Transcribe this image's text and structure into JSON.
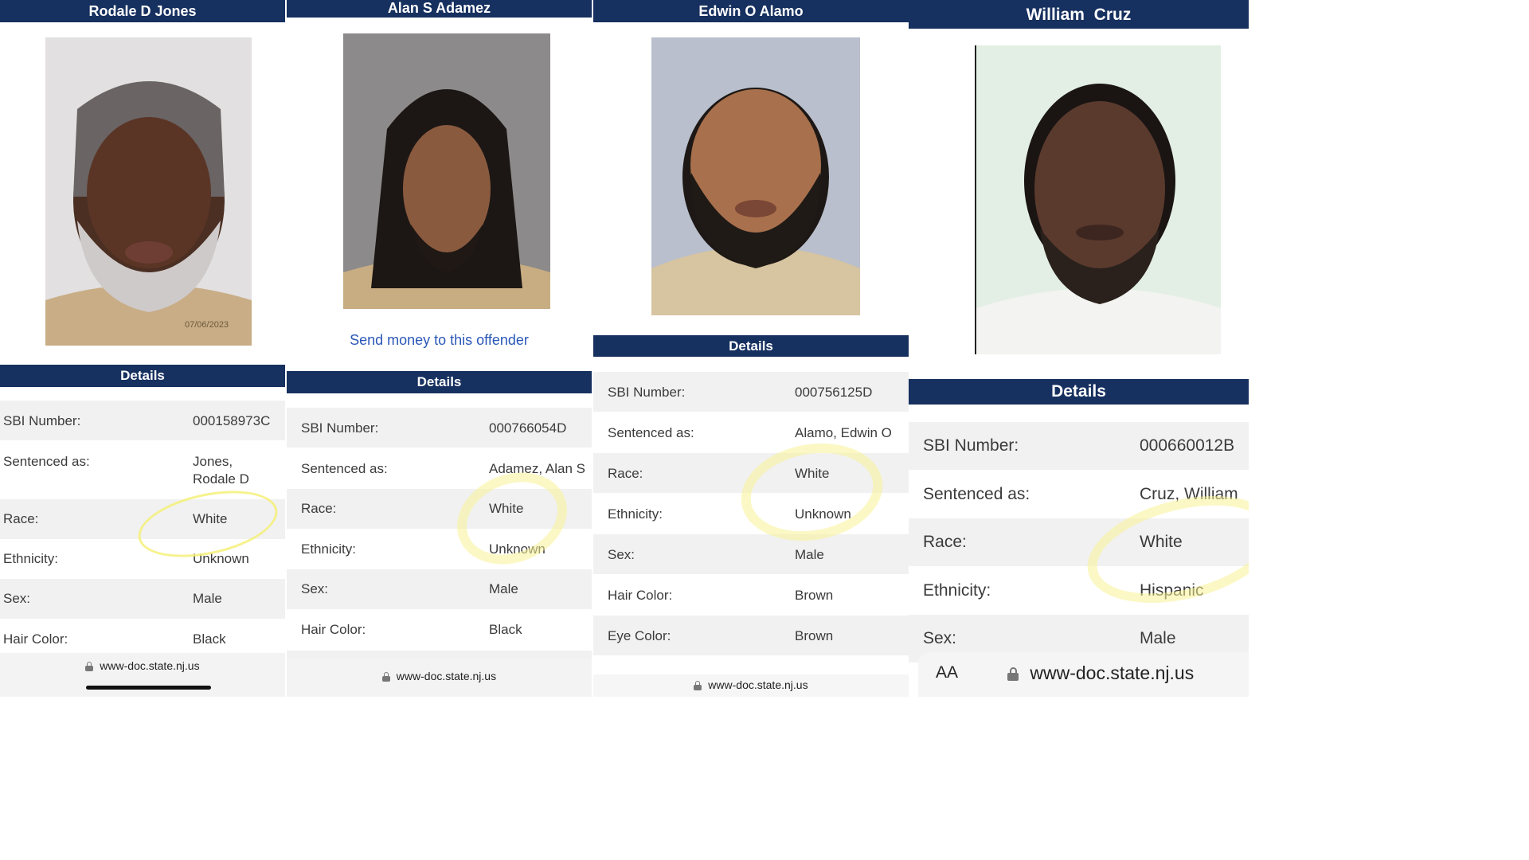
{
  "panels": [
    {
      "name": "Rodale D Jones",
      "details_heading": "Details",
      "photo_stamp": "07/06/2023",
      "rows": [
        {
          "label": "SBI Number:",
          "value": "000158973C"
        },
        {
          "label": "Sentenced as:",
          "value": "Jones,",
          "value2": "Rodale D"
        },
        {
          "label": "Race:",
          "value": "White"
        },
        {
          "label": "Ethnicity:",
          "value": "Unknown"
        },
        {
          "label": "Sex:",
          "value": "Male"
        },
        {
          "label": "Hair Color:",
          "value": "Black"
        }
      ],
      "url": "www-doc.state.nj.us"
    },
    {
      "name": "Alan S Adamez",
      "link": "Send money to this offender",
      "details_heading": "Details",
      "rows": [
        {
          "label": "SBI Number:",
          "value": "000766054D"
        },
        {
          "label": "Sentenced as:",
          "value": "Adamez, Alan S"
        },
        {
          "label": "Race:",
          "value": "White"
        },
        {
          "label": "Ethnicity:",
          "value": "Unknown"
        },
        {
          "label": "Sex:",
          "value": "Male"
        },
        {
          "label": "Hair Color:",
          "value": "Black"
        }
      ],
      "url": "www-doc.state.nj.us"
    },
    {
      "name": "Edwin O Alamo",
      "details_heading": "Details",
      "rows": [
        {
          "label": "SBI Number:",
          "value": "000756125D"
        },
        {
          "label": "Sentenced as:",
          "value": "Alamo, Edwin O"
        },
        {
          "label": "Race:",
          "value": "White"
        },
        {
          "label": "Ethnicity:",
          "value": "Unknown"
        },
        {
          "label": "Sex:",
          "value": "Male"
        },
        {
          "label": "Hair Color:",
          "value": "Brown"
        },
        {
          "label": "Eye Color:",
          "value": "Brown"
        }
      ],
      "url": "www-doc.state.nj.us"
    },
    {
      "name": "William  Cruz",
      "details_heading": "Details",
      "rows": [
        {
          "label": "SBI Number:",
          "value": "000660012B"
        },
        {
          "label": "Sentenced as:",
          "value": "Cruz, William"
        },
        {
          "label": "Race:",
          "value": "White"
        },
        {
          "label": "Ethnicity:",
          "value": "Hispanic"
        },
        {
          "label": "Sex:",
          "value": "Male"
        }
      ],
      "text_size_button": "AA",
      "url": "www-doc.state.nj.us"
    }
  ],
  "colors": {
    "header_bar": "#16305f",
    "row_shade": "#f1f1f1",
    "link": "#2a57b8",
    "highlight": "#f5f078"
  },
  "icons": [
    "lock-icon",
    "text-size-icon"
  ]
}
